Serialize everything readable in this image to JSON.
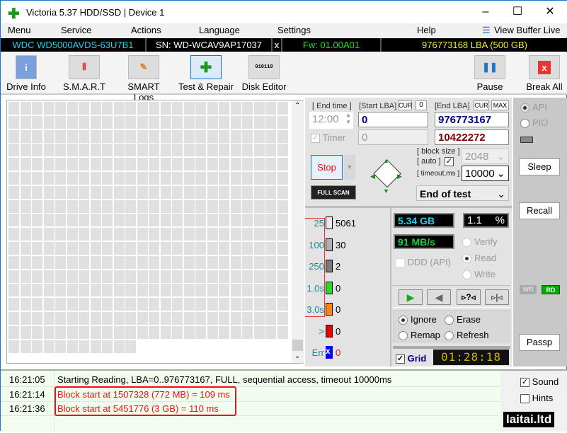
{
  "window": {
    "title": "Victoria 5.37 HDD/SSD | Device 1",
    "minimize": "–",
    "maximize": "☐",
    "close": "✕"
  },
  "menu": [
    "Menu",
    "Service",
    "Actions",
    "Language",
    "Settings",
    "Help"
  ],
  "view_buffer": "View Buffer Live",
  "info": {
    "model": "WDC WD5000AVDS-63U7B1",
    "serial": "SN: WD-WCAV9AP17037",
    "x": "x",
    "fw": "Fw: 01.00A01",
    "lba": "976773168 LBA (500 GB)"
  },
  "toolbar": {
    "drive_info": "Drive Info",
    "smart": "S.M.A.R.T",
    "smart_logs": "SMART Logs",
    "test_repair": "Test & Repair",
    "disk_editor": "Disk Editor",
    "pause": "Pause",
    "break_all": "Break All",
    "disk_editor_bits": "010110"
  },
  "test": {
    "end_time_label": "[ End time ]",
    "end_time": "12:00",
    "start_lba_label": "[Start LBA]",
    "cur": "CUR",
    "cur_val": "0",
    "end_lba_label": "[End LBA]",
    "max": "MAX",
    "start_lba": "0",
    "end_lba": "976773167",
    "timer": "Timer",
    "timer_val": "0",
    "current_lba": "10422272",
    "stop": "Stop",
    "full_scan": "FULL SCAN",
    "block_size_label": "[ block size ]",
    "auto_label": "[ auto ]",
    "block_size": "2048",
    "timeout_label": "[ timeout,ms ]",
    "timeout": "10000",
    "end_action": "End of test"
  },
  "legend": [
    {
      "label": "25",
      "count": "5061",
      "color": "#e8e8e8"
    },
    {
      "label": "100",
      "count": "30",
      "color": "#b0b0b0"
    },
    {
      "label": "250",
      "count": "2",
      "color": "#7a7a7a"
    },
    {
      "label": "1.0s",
      "count": "0",
      "color": "#22dd22"
    },
    {
      "label": "3.0s",
      "count": "0",
      "color": "#ff8800"
    },
    {
      "label": ">",
      "count": "0",
      "color": "#ee0000"
    },
    {
      "label": "Err",
      "count": "0",
      "color": "#0000ee"
    }
  ],
  "stats": {
    "size": "5.34 GB",
    "percent": "1.1",
    "percent_sign": "%",
    "speed": "91 MB/s",
    "ddd": "DDD (API)",
    "verify": "Verify",
    "read": "Read",
    "write": "Write"
  },
  "repair": {
    "ignore": "Ignore",
    "erase": "Erase",
    "remap": "Remap",
    "refresh": "Refresh"
  },
  "grid_label": "Grid",
  "timer_display": "01:28:18",
  "side": {
    "api": "API",
    "pio": "PIO",
    "sleep": "Sleep",
    "recall": "Recall",
    "wr": "WR",
    "rd": "RD",
    "passp": "Passp"
  },
  "log": [
    {
      "time": "16:21:05",
      "text": "Starting Reading, LBA=0..976773167, FULL, sequential access, timeout 10000ms",
      "color": "#000"
    },
    {
      "time": "16:21:14",
      "text": "Block start at 1507328 (772 MB)  = 109 ms",
      "color": "#ee1111"
    },
    {
      "time": "16:21:36",
      "text": "Block start at 5451776 (3 GB)  = 110 ms",
      "color": "#ee1111"
    }
  ],
  "sound": "Sound",
  "hints": "Hints",
  "watermark": "laitai.ltd"
}
